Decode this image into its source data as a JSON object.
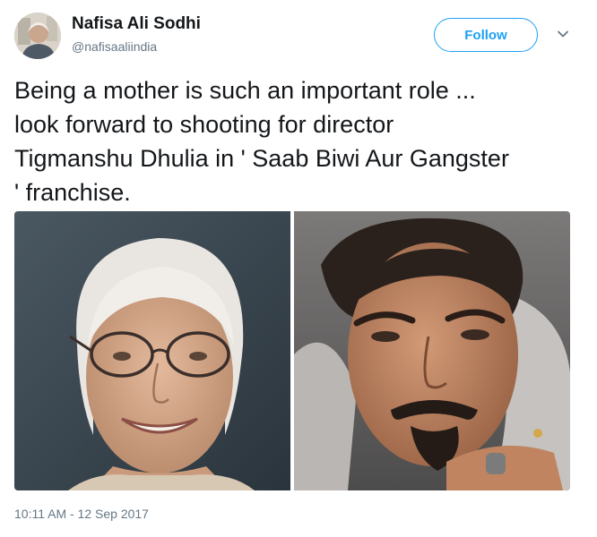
{
  "tweet": {
    "author_name": "Nafisa Ali Sodhi",
    "author_handle": "@nafisaaliindia",
    "follow_label": "Follow",
    "text": "Being a mother is such an important role ...\nlook forward to shooting for director\nTigmanshu Dhulia in ' Saab Biwi Aur Gangster\n' franchise.",
    "timestamp": "10:11 AM - 12 Sep 2017"
  },
  "icons": {
    "more": "chevron-down-icon"
  },
  "colors": {
    "accent": "#1da1f2",
    "muted": "#657786",
    "text": "#14171a"
  }
}
